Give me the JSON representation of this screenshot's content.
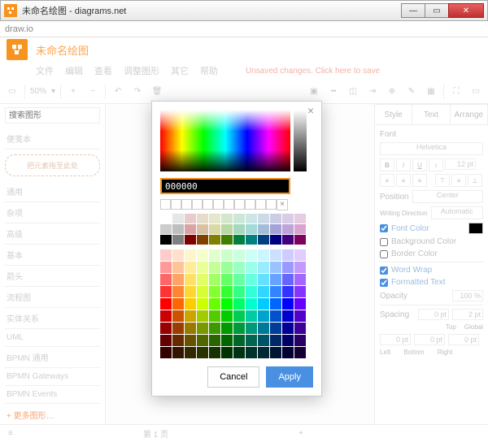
{
  "window": {
    "title": "未命名绘图 - diagrams.net"
  },
  "tab": {
    "label": "draw.io"
  },
  "doc": {
    "title": "未命名绘图"
  },
  "menu": {
    "file": "文件",
    "edit": "编辑",
    "view": "查看",
    "adjust": "调整图形",
    "other": "其它",
    "help": "帮助",
    "unsaved": "Unsaved changes. Click here to save"
  },
  "toolbar": {
    "zoom": "50%"
  },
  "sidebar": {
    "search_placeholder": "搜索图形",
    "scratchpad": "便笺本",
    "drop_hint": "把元素拖至此处",
    "sections": [
      "通用",
      "杂项",
      "高级",
      "基本",
      "箭头",
      "流程图",
      "实体关系",
      "UML",
      "BPMN 通用",
      "BPMN Gateways",
      "BPMN Events"
    ],
    "more": "+ 更多图形…"
  },
  "right_panel": {
    "tabs": {
      "style": "Style",
      "text": "Text",
      "arrange": "Arrange"
    },
    "font_label": "Font",
    "font_value": "Helvetica",
    "font_size": "12 pt",
    "position_label": "Position",
    "position_value": "Center",
    "direction_label": "Writing Direction",
    "direction_value": "Automatic",
    "font_color": "Font Color",
    "bg_color": "Background Color",
    "border_color": "Border Color",
    "word_wrap": "Word Wrap",
    "formatted": "Formatted Text",
    "opacity_label": "Opacity",
    "opacity_value": "100 %",
    "spacing_label": "Spacing",
    "spacing": {
      "global": "0 pt",
      "top": "2 pt",
      "left": "0 pt",
      "bottom": "0 pt",
      "right": "0 pt"
    },
    "spacing_labels": {
      "top": "Top",
      "global": "Global",
      "left": "Left",
      "bottom": "Bottom",
      "right": "Right"
    }
  },
  "footer": {
    "page": "第 1 页",
    "add": "+"
  },
  "color_picker": {
    "hex": "000000",
    "cancel": "Cancel",
    "apply": "Apply",
    "preset_colors": [
      "#ffffff",
      "#e6e6e6",
      "#e6cccc",
      "#e6dccc",
      "#e6e6cc",
      "#d4e6cc",
      "#cce6d9",
      "#cce6e6",
      "#ccd9e6",
      "#cccce6",
      "#d9cce6",
      "#e6cce0",
      "#cccccc",
      "#bfbfbf",
      "#d9a3a3",
      "#d9c2a3",
      "#d9d9a3",
      "#b8d9a3",
      "#a3d9bd",
      "#a3d9d9",
      "#a3bdd9",
      "#a3a3d9",
      "#bda3d9",
      "#d9a3cf",
      "#000000",
      "#808080",
      "#800000",
      "#804000",
      "#808000",
      "#408000",
      "#008040",
      "#008080",
      "#004080",
      "#000080",
      "#400080",
      "#800060"
    ],
    "main_colors": [
      "#ffcccc",
      "#ffe0cc",
      "#fff5cc",
      "#f5ffcc",
      "#e0ffcc",
      "#ccffcc",
      "#ccffe0",
      "#ccfff5",
      "#ccf5ff",
      "#cce0ff",
      "#ccccff",
      "#e0ccff",
      "#ff9999",
      "#ffc299",
      "#ffeb99",
      "#ebff99",
      "#c2ff99",
      "#99ff99",
      "#99ffc2",
      "#99ffeb",
      "#99ebff",
      "#99c2ff",
      "#9999ff",
      "#c299ff",
      "#ff6666",
      "#ffa366",
      "#ffe066",
      "#e0ff66",
      "#a3ff66",
      "#66ff66",
      "#66ffa3",
      "#66ffe0",
      "#66e0ff",
      "#66a3ff",
      "#6666ff",
      "#a366ff",
      "#ff3333",
      "#ff8533",
      "#ffd633",
      "#d6ff33",
      "#85ff33",
      "#33ff33",
      "#33ff85",
      "#33ffd6",
      "#33d6ff",
      "#3385ff",
      "#3333ff",
      "#8533ff",
      "#ff0000",
      "#ff6600",
      "#ffcc00",
      "#ccff00",
      "#66ff00",
      "#00ff00",
      "#00ff66",
      "#00ffcc",
      "#00ccff",
      "#0066ff",
      "#0000ff",
      "#6600ff",
      "#cc0000",
      "#cc5200",
      "#cca300",
      "#a3cc00",
      "#52cc00",
      "#00cc00",
      "#00cc52",
      "#00cca3",
      "#00a3cc",
      "#0052cc",
      "#0000cc",
      "#5200cc",
      "#990000",
      "#993d00",
      "#997a00",
      "#7a9900",
      "#3d9900",
      "#009900",
      "#00993d",
      "#00997a",
      "#007a99",
      "#003d99",
      "#000099",
      "#3d0099",
      "#660000",
      "#662900",
      "#665200",
      "#526600",
      "#296600",
      "#006600",
      "#006629",
      "#006652",
      "#005266",
      "#002966",
      "#000066",
      "#290066",
      "#330000",
      "#331400",
      "#332900",
      "#293300",
      "#143300",
      "#003300",
      "#003314",
      "#003329",
      "#002933",
      "#001433",
      "#000033",
      "#140033"
    ]
  }
}
